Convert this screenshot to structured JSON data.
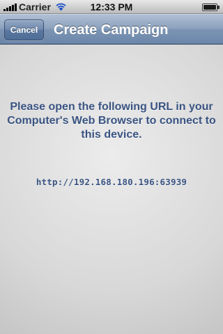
{
  "status_bar": {
    "carrier": "Carrier",
    "time": "12:33 PM",
    "signal_bars": 5,
    "wifi_icon": "wifi-icon",
    "battery_level": 1.0
  },
  "nav_bar": {
    "cancel_label": "Cancel",
    "title": "Create Campaign"
  },
  "content": {
    "instructions": "Please open the following URL in your Computer's Web Browser to connect to this device.",
    "url": "http://192.168.180.196:63939"
  },
  "colors": {
    "nav_bar": "#7d95b4",
    "text_accent": "#3a5482",
    "background": "#d6d6d6"
  }
}
